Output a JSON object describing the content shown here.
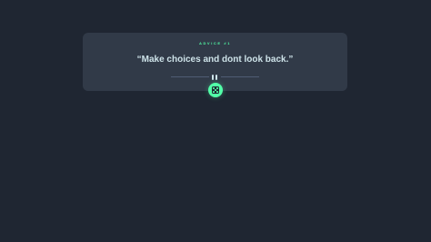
{
  "card": {
    "advice_id_label": "ADVICE #1",
    "quote": "“Make choices and dont look back.”"
  },
  "dice_button": {
    "icon": "dice-icon"
  },
  "colors": {
    "background": "#1f2632",
    "card": "#313a48",
    "accent": "#52ffa8",
    "text": "#cee3e9",
    "divider": "#4f5d74"
  }
}
